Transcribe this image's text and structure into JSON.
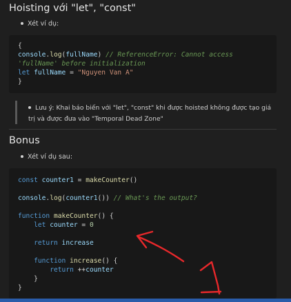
{
  "section1": {
    "title": "Hoisting với \"let\", \"const\"",
    "bullet": "Xét ví dụ:",
    "code": {
      "l1": "{",
      "l2_obj": "console",
      "l2_fn": "log",
      "l2_arg": "fullName",
      "l2_comment": "// ReferenceError: Cannot access",
      "l3_comment": "'fullName' before initialization",
      "l4_kw": "let",
      "l4_var": "fullName",
      "l4_str": "\"Nguyen Van A\"",
      "l5": "}"
    },
    "note": "Lưu ý: Khai báo biến với \"let\", \"const\" khi được hoisted không được tạo giá trị và được đưa vào \"Temporal Dead Zone\""
  },
  "section2": {
    "title": "Bonus",
    "bullet": "Xét ví dụ sau:",
    "code": {
      "l1_kw": "const",
      "l1_var": "counter1",
      "l1_fn": "makeCounter",
      "l2_obj": "console",
      "l2_fn": "log",
      "l2_var": "counter1",
      "l2_comment": "// What's the output?",
      "l3_kw": "function",
      "l3_fn": "makeCounter",
      "l4_kw": "let",
      "l4_var": "counter",
      "l4_num": "0",
      "l5_kw": "return",
      "l5_var": "increase",
      "l6_kw": "function",
      "l6_fn": "increase",
      "l7_kw": "return",
      "l7_var": "counter",
      "l8": "}",
      "l9": "}"
    }
  },
  "annotation": {
    "color": "#e8282b",
    "label": "1"
  },
  "colors": {
    "background": "#1f1f1f",
    "code_background": "#181818",
    "keyword": "#569cd6",
    "function": "#dcdcaa",
    "variable": "#9cdcfe",
    "string": "#ce9178",
    "comment": "#6a9955"
  }
}
